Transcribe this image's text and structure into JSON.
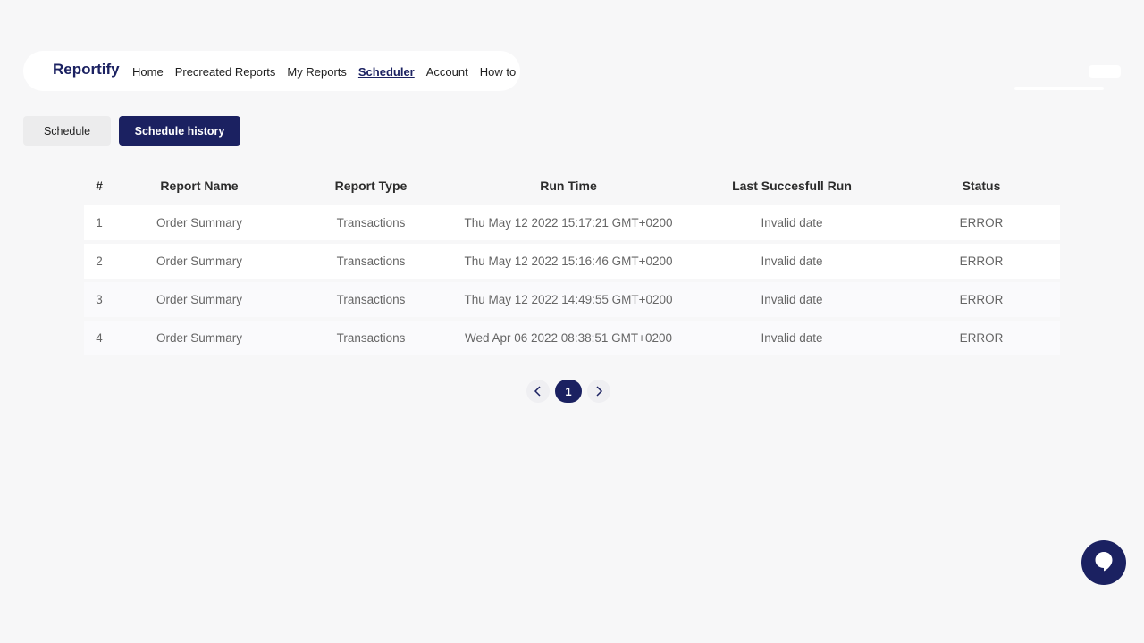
{
  "brand": "Reportify",
  "nav": [
    {
      "label": "Home",
      "active": false
    },
    {
      "label": "Precreated Reports",
      "active": false
    },
    {
      "label": "My Reports",
      "active": false
    },
    {
      "label": "Scheduler",
      "active": true
    },
    {
      "label": "Account",
      "active": false
    },
    {
      "label": "How to",
      "active": false
    }
  ],
  "tabs": {
    "schedule": "Schedule",
    "history": "Schedule history"
  },
  "table": {
    "headers": [
      "#",
      "Report Name",
      "Report Type",
      "Run Time",
      "Last Succesfull Run",
      "Status"
    ],
    "rows": [
      [
        "1",
        "Order Summary",
        "Transactions",
        "Thu May 12 2022 15:17:21 GMT+0200",
        "Invalid date",
        "ERROR"
      ],
      [
        "2",
        "Order Summary",
        "Transactions",
        "Thu May 12 2022 15:16:46 GMT+0200",
        "Invalid date",
        "ERROR"
      ],
      [
        "3",
        "Order Summary",
        "Transactions",
        "Thu May 12 2022 14:49:55 GMT+0200",
        "Invalid date",
        "ERROR"
      ],
      [
        "4",
        "Order Summary",
        "Transactions",
        "Wed Apr 06 2022 08:38:51 GMT+0200",
        "Invalid date",
        "ERROR"
      ]
    ]
  },
  "pagination": {
    "current": "1",
    "prev_icon": "chevron-left-icon",
    "next_icon": "chevron-right-icon"
  },
  "chat": {
    "icon": "chat-bubble-icon"
  },
  "colors": {
    "primary": "#1b2161",
    "background": "#f7f7f8"
  }
}
